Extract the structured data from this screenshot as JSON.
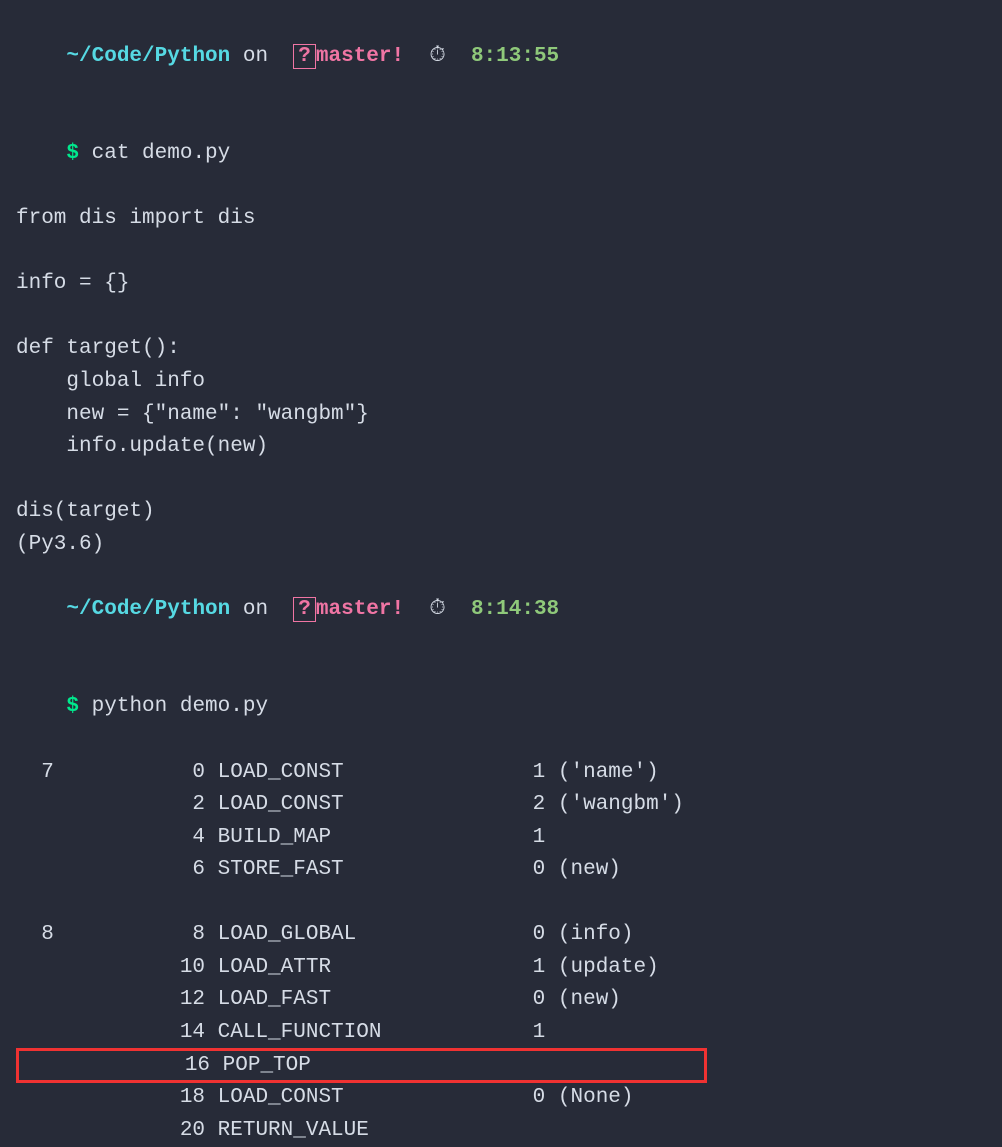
{
  "prompt1": {
    "path": "~/Code/Python",
    "on": " on ",
    "branch_indicator": "?",
    "branch": "master!",
    "clock_icon": "⏱",
    "time": "8:13:55"
  },
  "cmd1": {
    "dollar": "$ ",
    "command": "cat demo.py"
  },
  "source": {
    "line1": "from dis import dis",
    "line2": "",
    "line3": "info = {}",
    "line4": "",
    "line5": "def target():",
    "line6": "    global info",
    "line7": "    new = {\"name\": \"wangbm\"}",
    "line8": "    info.update(new)",
    "line9": "",
    "line10": "dis(target)",
    "line11": "(Py3.6)"
  },
  "prompt2": {
    "path": "~/Code/Python",
    "on": " on ",
    "branch_indicator": "?",
    "branch": "master!",
    "clock_icon": "⏱",
    "time": "8:14:38"
  },
  "cmd2": {
    "dollar": "$ ",
    "command": "python demo.py"
  },
  "dis": {
    "l1": "  7           0 LOAD_CONST               1 ('name')",
    "l2": "              2 LOAD_CONST               2 ('wangbm')",
    "l3": "              4 BUILD_MAP                1",
    "l4": "              6 STORE_FAST               0 (new)",
    "l5": "",
    "l6": "  8           8 LOAD_GLOBAL              0 (info)",
    "l7": "             10 LOAD_ATTR                1 (update)",
    "l8": "             12 LOAD_FAST                0 (new)",
    "l9": "             14 CALL_FUNCTION            1",
    "l10": "             16 POP_TOP                               ",
    "l11": "             18 LOAD_CONST               0 (None)",
    "l12": "             20 RETURN_VALUE"
  }
}
